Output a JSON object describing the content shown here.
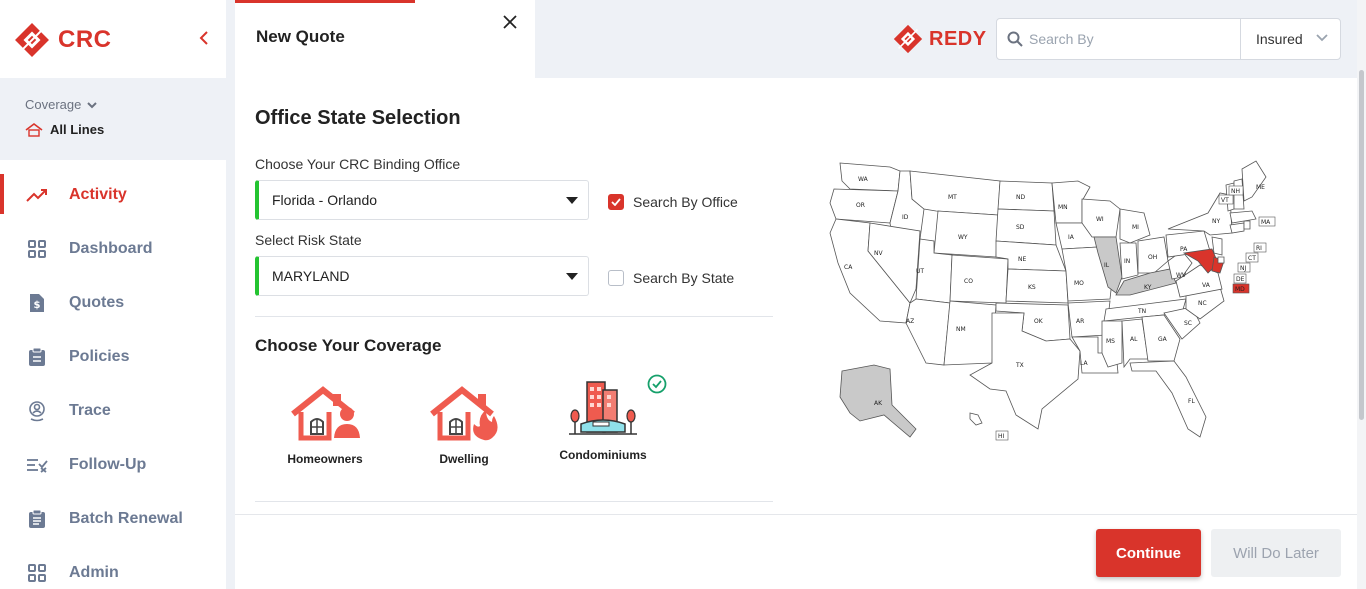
{
  "sidebar": {
    "brand": "CRC",
    "coverage_label": "Coverage",
    "coverage_value": "All Lines",
    "items": [
      {
        "label": "Activity",
        "icon": "trending-up-icon",
        "active": true
      },
      {
        "label": "Dashboard",
        "icon": "grid-icon"
      },
      {
        "label": "Quotes",
        "icon": "dollar-file-icon"
      },
      {
        "label": "Policies",
        "icon": "clipboard-icon"
      },
      {
        "label": "Trace",
        "icon": "location-person-icon"
      },
      {
        "label": "Follow-Up",
        "icon": "list-check-icon"
      },
      {
        "label": "Batch Renewal",
        "icon": "clipboard-list-icon"
      },
      {
        "label": "Admin",
        "icon": "grid-icon"
      }
    ]
  },
  "tab": {
    "title": "New Quote"
  },
  "header": {
    "brand": "REDY",
    "search_placeholder": "Search By",
    "search_type": "Insured"
  },
  "form": {
    "section_title": "Office State Selection",
    "office_label": "Choose Your CRC Binding Office",
    "office_value": "Florida - Orlando",
    "search_by_office": "Search By Office",
    "search_by_office_checked": true,
    "risk_label": "Select Risk State",
    "risk_value": "MARYLAND",
    "search_by_state": "Search By State",
    "search_by_state_checked": false,
    "coverage_title": "Choose Your Coverage",
    "coverages": [
      "Homeowners",
      "Dwelling",
      "Condominiums"
    ],
    "selected_coverage": "Condominiums"
  },
  "map": {
    "highlighted": "MD",
    "shaded": [
      "IL",
      "KY",
      "AK"
    ],
    "labels": {
      "WA": "WA",
      "OR": "OR",
      "CA": "CA",
      "ID": "ID",
      "NV": "NV",
      "MT": "MT",
      "WY": "WY",
      "UT": "UT",
      "AZ": "AZ",
      "CO": "CO",
      "NM": "NM",
      "ND": "ND",
      "SD": "SD",
      "NE": "NE",
      "KS": "KS",
      "OK": "OK",
      "TX": "TX",
      "MN": "MN",
      "IA": "IA",
      "MO": "MO",
      "AR": "AR",
      "LA": "LA",
      "WI": "WI",
      "IL": "IL",
      "MI": "MI",
      "IN": "IN",
      "OH": "OH",
      "KY": "KY",
      "TN": "TN",
      "MS": "MS",
      "AL": "AL",
      "GA": "GA",
      "FL": "FL",
      "SC": "SC",
      "NC": "NC",
      "VA": "VA",
      "WV": "WV",
      "PA": "PA",
      "NY": "NY",
      "ME": "ME",
      "VT": "VT",
      "NH": "NH",
      "MA": "MA",
      "RI": "RI",
      "CT": "CT",
      "NJ": "NJ",
      "DE": "DE",
      "MD": "MD",
      "AK": "AK",
      "HI": "HI"
    }
  },
  "footer": {
    "continue": "Continue",
    "later": "Will Do Later"
  },
  "colors": {
    "brand_red": "#d9342b",
    "valid_green": "#24c431",
    "nav_gray": "#6c7a93"
  }
}
